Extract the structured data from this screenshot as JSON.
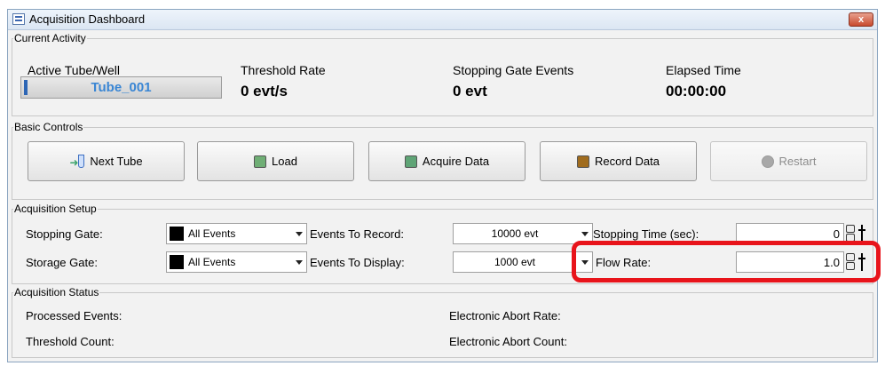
{
  "window": {
    "title": "Acquisition Dashboard",
    "close_symbol": "x"
  },
  "current_activity": {
    "legend": "Current Activity",
    "active_label": "Active Tube/Well",
    "active_value": "Tube_001",
    "threshold_label": "Threshold Rate",
    "threshold_value": "0 evt/s",
    "stopping_label": "Stopping Gate Events",
    "stopping_value": "0 evt",
    "elapsed_label": "Elapsed Time",
    "elapsed_value": "00:00:00"
  },
  "basic_controls": {
    "legend": "Basic Controls",
    "buttons": [
      {
        "label": "Next Tube",
        "icon": "tube-arrow-icon",
        "enabled": true
      },
      {
        "label": "Load",
        "icon": "square-green-icon",
        "color": "#6fae75",
        "enabled": true
      },
      {
        "label": "Acquire Data",
        "icon": "square-green-icon",
        "color": "#5fa476",
        "enabled": true
      },
      {
        "label": "Record Data",
        "icon": "square-brown-icon",
        "color": "#a06c1e",
        "enabled": true
      },
      {
        "label": "Restart",
        "icon": "circle-gray-icon",
        "color": "#a8a8a8",
        "enabled": false
      }
    ]
  },
  "acquisition_setup": {
    "legend": "Acquisition Setup",
    "stopping_gate_label": "Stopping Gate:",
    "stopping_gate_value": "All Events",
    "storage_gate_label": "Storage Gate:",
    "storage_gate_value": "All Events",
    "events_to_record_label": "Events To Record:",
    "events_to_record_value": "10000 evt",
    "events_to_display_label": "Events To Display:",
    "events_to_display_value": "1000 evt",
    "stopping_time_label": "Stopping Time (sec):",
    "stopping_time_value": "0",
    "flow_rate_label": "Flow Rate:",
    "flow_rate_value": "1.0"
  },
  "acquisition_status": {
    "legend": "Acquisition Status",
    "processed_events_label": "Processed Events:",
    "threshold_count_label": "Threshold Count:",
    "electronic_abort_rate_label": "Electronic Abort Rate:",
    "electronic_abort_count_label": "Electronic Abort Count:"
  },
  "colors": {
    "highlight": "#e8141b",
    "tube_text": "#3a86d4"
  }
}
